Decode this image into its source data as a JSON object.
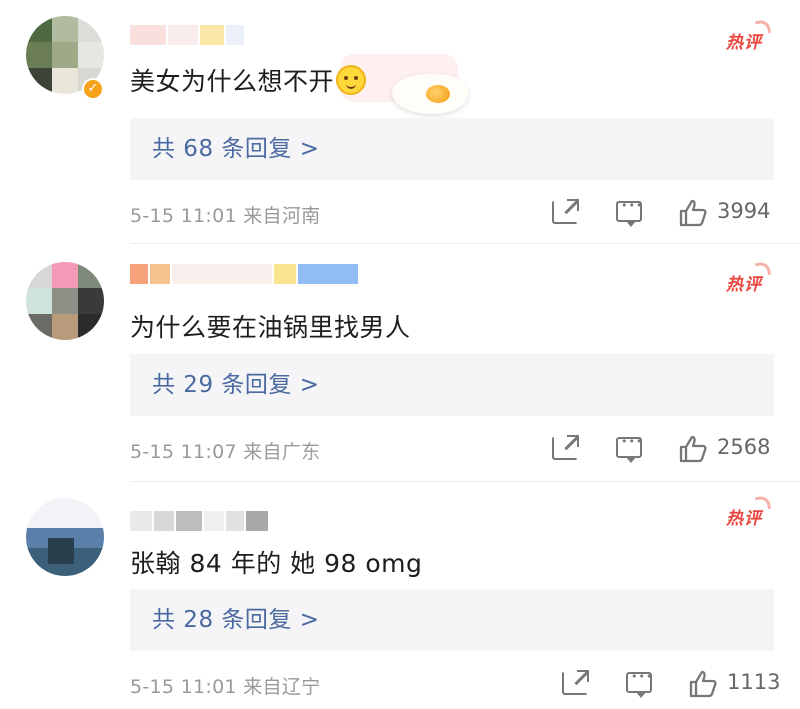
{
  "comments": [
    {
      "text": "美女为什么想不开",
      "emoji": "sun-smile-emoji",
      "badge": "热评",
      "replies": "共 68 条回复 >",
      "meta": "5-15 11:01 来自河南",
      "likes": "3994",
      "verified": true
    },
    {
      "text": "为什么要在油锅里找男人",
      "badge": "热评",
      "replies": "共 29 条回复 >",
      "meta": "5-15 11:07 来自广东",
      "likes": "2568",
      "verified": false
    },
    {
      "text": "张翰 84 年的 她 98 omg",
      "badge": "热评",
      "replies": "共 28 条回复 >",
      "meta": "5-15 11:01 来自辽宁",
      "likes": "1113",
      "verified": false
    }
  ],
  "colors": {
    "accent_link": "#4a6aa1",
    "hot_badge": "#e8483f",
    "verified": "#f7a21b",
    "meta_gray": "#9a9a9a"
  },
  "icons": [
    "share-icon",
    "comment-icon",
    "like-icon",
    "verified-icon"
  ]
}
